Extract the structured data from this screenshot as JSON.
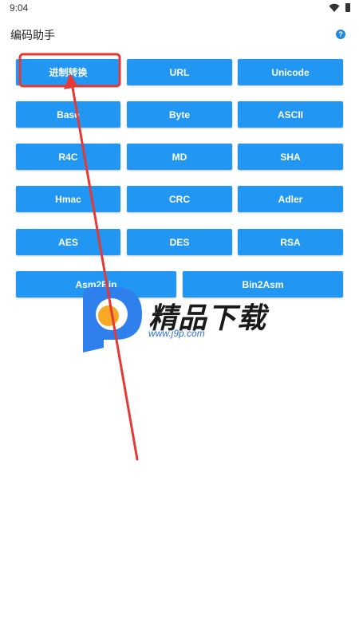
{
  "status_bar": {
    "time": "9:04",
    "wifi_icon": "wifi-icon",
    "battery_icon": "battery-icon"
  },
  "app": {
    "title": "编码助手",
    "help_icon": "help-icon",
    "help_glyph": "?"
  },
  "buttons": {
    "jinzhi": "进制转换",
    "url": "URL",
    "unicode": "Unicode",
    "base": "Base",
    "byte": "Byte",
    "ascii": "ASCII",
    "r4c": "R4C",
    "md": "MD",
    "sha": "SHA",
    "hmac": "Hmac",
    "crc": "CRC",
    "adler": "Adler",
    "aes": "AES",
    "des": "DES",
    "rsa": "RSA",
    "asm2bin": "Asm2Bin",
    "bin2asm": "Bin2Asm"
  },
  "watermark": {
    "text": "精品下载",
    "url": "www.j9p.com"
  },
  "colors": {
    "button": "#2196f3",
    "highlight": "#e53935",
    "help": "#1e88e5"
  }
}
